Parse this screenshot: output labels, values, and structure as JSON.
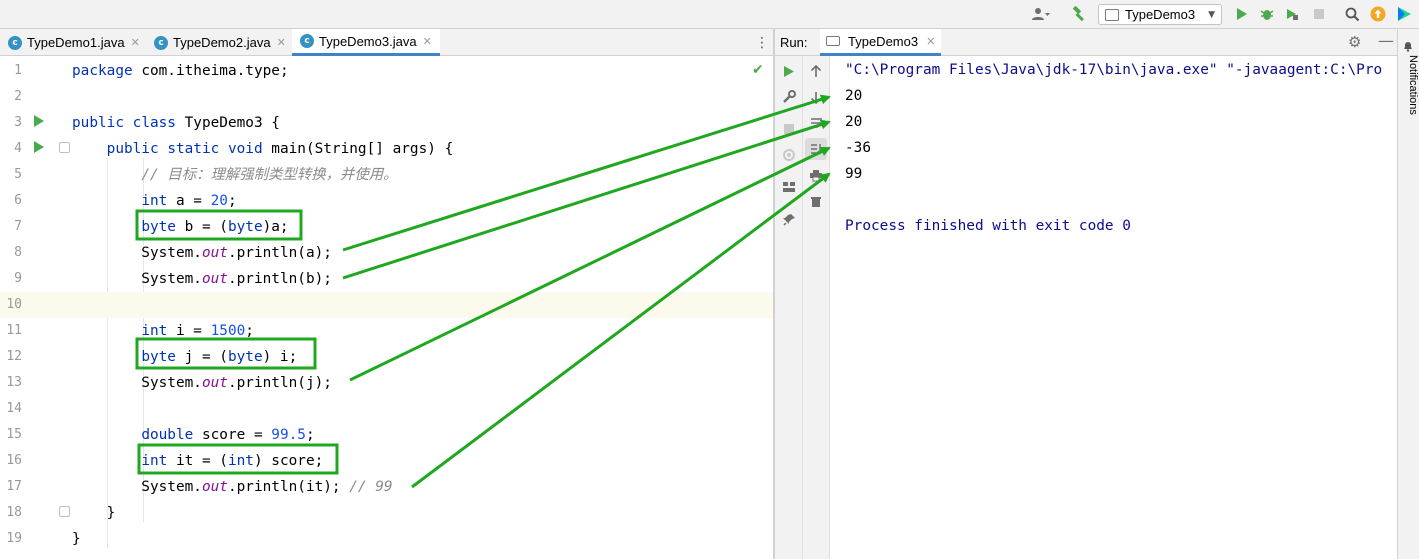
{
  "toolbar": {
    "run_config": "TypeDemo3",
    "icons": [
      "user-icon",
      "hammer-icon",
      "run-icon",
      "debug-icon",
      "coverage-icon",
      "stop-icon",
      "search-icon",
      "update-icon",
      "jetbrains-logo"
    ]
  },
  "editor_tabs": [
    {
      "label": "TypeDemo1.java",
      "active": false
    },
    {
      "label": "TypeDemo2.java",
      "active": false
    },
    {
      "label": "TypeDemo3.java",
      "active": true
    }
  ],
  "code_lines": [
    {
      "n": "1",
      "text": "package com.itheima.type;"
    },
    {
      "n": "2",
      "text": ""
    },
    {
      "n": "3",
      "text": "public class TypeDemo3 {"
    },
    {
      "n": "4",
      "text": "    public static void main(String[] args) {"
    },
    {
      "n": "5",
      "text": "        // 目标：理解强制类型转换，并使用。"
    },
    {
      "n": "6",
      "text": "        int a = 20;"
    },
    {
      "n": "7",
      "text": "        byte b = (byte)a;"
    },
    {
      "n": "8",
      "text": "        System.out.println(a);"
    },
    {
      "n": "9",
      "text": "        System.out.println(b);"
    },
    {
      "n": "10",
      "text": ""
    },
    {
      "n": "11",
      "text": "        int i = 1500;"
    },
    {
      "n": "12",
      "text": "        byte j = (byte) i;"
    },
    {
      "n": "13",
      "text": "        System.out.println(j);"
    },
    {
      "n": "14",
      "text": ""
    },
    {
      "n": "15",
      "text": "        double score = 99.5;"
    },
    {
      "n": "16",
      "text": "        int it = (int) score;"
    },
    {
      "n": "17",
      "text": "        System.out.println(it); // 99"
    },
    {
      "n": "18",
      "text": "    }"
    },
    {
      "n": "19",
      "text": "}"
    }
  ],
  "run_panel": {
    "label": "Run:",
    "tab": "TypeDemo3",
    "command": "\"C:\\Program Files\\Java\\jdk-17\\bin\\java.exe\" \"-javaagent:C:\\Pro",
    "outputs": [
      "20",
      "20",
      "-36",
      "99"
    ],
    "finished": "Process finished with exit code 0"
  },
  "right_sidebar": {
    "notifications": "Notifications"
  },
  "colors": {
    "annotation": "#1fa81f",
    "keyword": "#0033b3",
    "number": "#1750eb",
    "tab_underline": "#4083c9"
  }
}
